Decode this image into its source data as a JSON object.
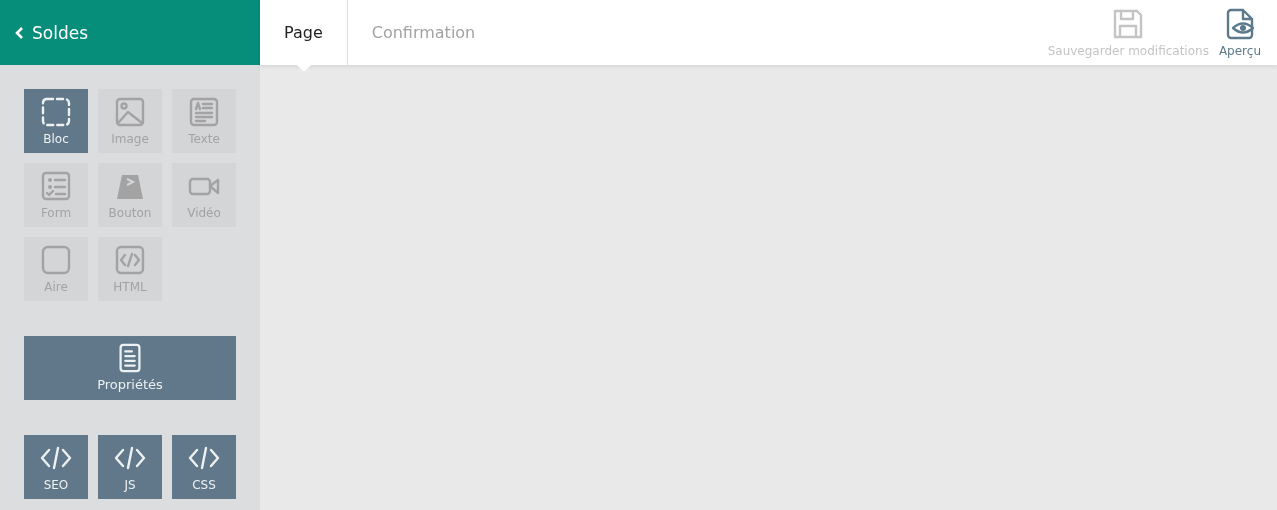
{
  "header": {
    "back_label": "Soldes"
  },
  "tools": [
    {
      "kind": "bloc",
      "label": "Bloc",
      "selected": true
    },
    {
      "kind": "image",
      "label": "Image",
      "selected": false
    },
    {
      "kind": "texte",
      "label": "Texte",
      "selected": false
    },
    {
      "kind": "form",
      "label": "Form",
      "selected": false
    },
    {
      "kind": "bouton",
      "label": "Bouton",
      "selected": false
    },
    {
      "kind": "video",
      "label": "Vidéo",
      "selected": false
    },
    {
      "kind": "aire",
      "label": "Aire",
      "selected": false
    },
    {
      "kind": "html",
      "label": "HTML",
      "selected": false
    }
  ],
  "properties_button": {
    "label": "Propriétés"
  },
  "code_buttons": [
    {
      "label": "SEO"
    },
    {
      "label": "JS"
    },
    {
      "label": "CSS"
    }
  ],
  "tabs": [
    {
      "label": "Page",
      "selected": true
    },
    {
      "label": "Confirmation",
      "selected": false
    }
  ],
  "actions": [
    {
      "kind": "save",
      "label": "Sauvegarder modifications",
      "disabled": true
    },
    {
      "kind": "preview",
      "label": "Aperçu",
      "disabled": false
    }
  ]
}
